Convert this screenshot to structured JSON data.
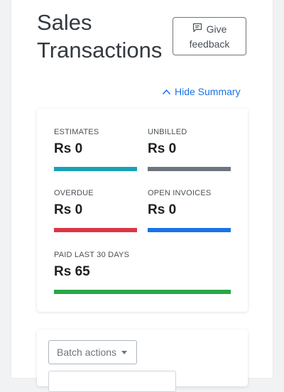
{
  "header": {
    "title_line1": "Sales",
    "title_line2": "Transactions",
    "feedback_line1": "Give",
    "feedback_line2": "feedback"
  },
  "summary_toggle": {
    "label": "Hide Summary"
  },
  "summary": {
    "items": [
      {
        "label": "ESTIMATES",
        "value": "Rs 0",
        "color": "#17a2b8"
      },
      {
        "label": "UNBILLED",
        "value": "Rs 0",
        "color": "#6c757d"
      },
      {
        "label": "OVERDUE",
        "value": "Rs 0",
        "color": "#dc3545"
      },
      {
        "label": "OPEN INVOICES",
        "value": "Rs 0",
        "color": "#1a73e8"
      },
      {
        "label": "PAID LAST 30 DAYS",
        "value": "Rs 65",
        "color": "#28a745"
      }
    ]
  },
  "toolbar": {
    "batch_actions_label": "Batch actions"
  },
  "icons": {
    "feedback": "message-square-icon",
    "toggle": "chevron-up-icon",
    "dropdown": "caret-down-icon"
  }
}
